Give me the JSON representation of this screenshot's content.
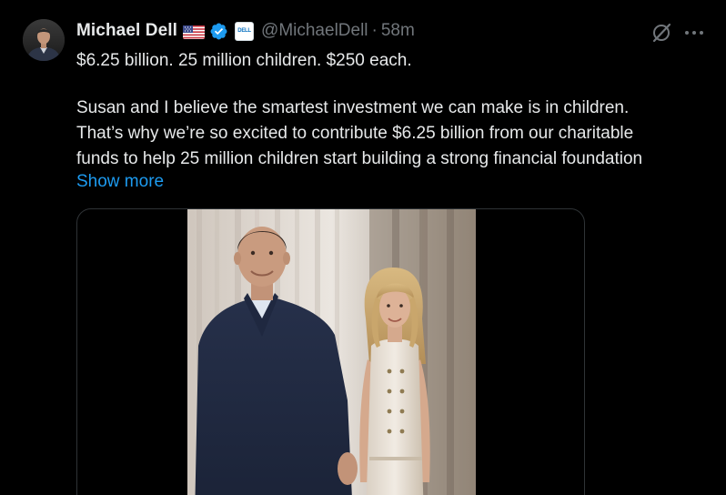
{
  "author": {
    "name": "Michael Dell",
    "handle": "@MichaelDell",
    "separator": "·",
    "time": "58m",
    "affiliate_badge": "DELL"
  },
  "tweet": {
    "lines": [
      "$6.25 billion. 25 million children. $250 each.",
      "Susan and I believe the smartest investment we can make is in children.",
      "That’s why we’re so excited to contribute $6.25 billion from our charitable",
      "funds to help 25 million children start building a strong financial foundation"
    ],
    "show_more": "Show more"
  },
  "icons": {
    "flag": "us-flag-icon",
    "verified": "verified-badge-icon",
    "grok": "grok-icon",
    "more": "more-icon"
  },
  "colors": {
    "background": "#000000",
    "text": "#e7e9ea",
    "secondary": "#71767b",
    "accent": "#1d9bf0",
    "border": "#2f3336"
  }
}
